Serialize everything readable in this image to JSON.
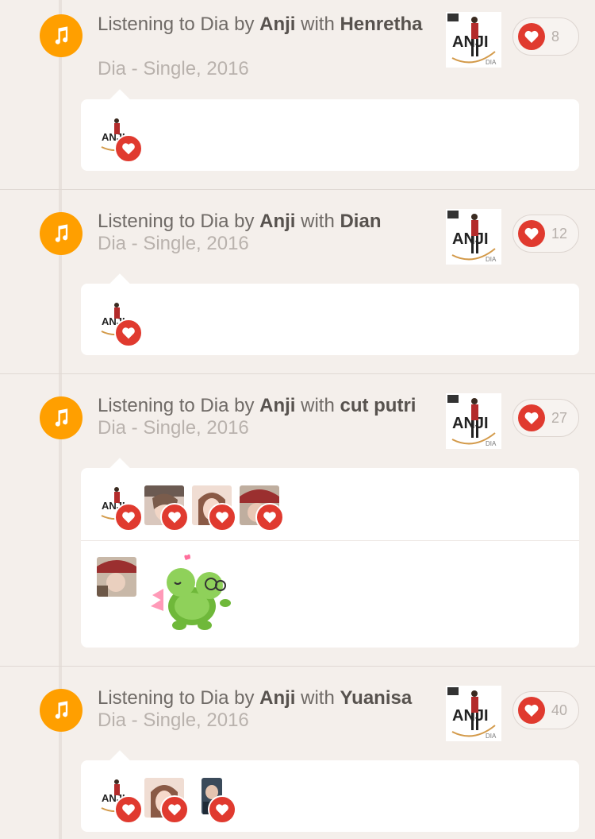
{
  "colors": {
    "background": "#f4efeb",
    "music_accent": "#ff9f00",
    "heart_red": "#e03a2f",
    "text_primary": "#57524e",
    "text_secondary": "#b9b2ad"
  },
  "moments": [
    {
      "prefix": "Listening to Dia by ",
      "artist": "Anji",
      "with_word": " with ",
      "friend": "Henretha",
      "subtitle": "Dia - Single, 2016",
      "like_count": "8",
      "album_icon": "album-cover-anji-dia",
      "likers": [
        "anji-avatar"
      ]
    },
    {
      "prefix": "Listening to Dia by ",
      "artist": "Anji",
      "with_word": " with ",
      "friend": "Dian",
      "subtitle": "Dia - Single, 2016",
      "like_count": "12",
      "album_icon": "album-cover-anji-dia",
      "likers": [
        "anji-avatar"
      ]
    },
    {
      "prefix": "Listening to Dia by ",
      "artist": "Anji",
      "with_word": " with ",
      "friend": "cut putri",
      "subtitle": "Dia - Single, 2016",
      "like_count": "27",
      "album_icon": "album-cover-anji-dia",
      "likers": [
        "anji-avatar",
        "user-photo-1",
        "user-photo-2",
        "user-photo-3"
      ],
      "comment": {
        "avatar": "commenter-photo",
        "sticker": "turtle-couple-sticker"
      }
    },
    {
      "prefix": "Listening to Dia by ",
      "artist": "Anji",
      "with_word": " with ",
      "friend": "Yuanisa",
      "subtitle": "Dia - Single, 2016",
      "like_count": "40",
      "album_icon": "album-cover-anji-dia",
      "likers": [
        "anji-avatar",
        "user-photo-2",
        "user-photo-4"
      ]
    }
  ]
}
